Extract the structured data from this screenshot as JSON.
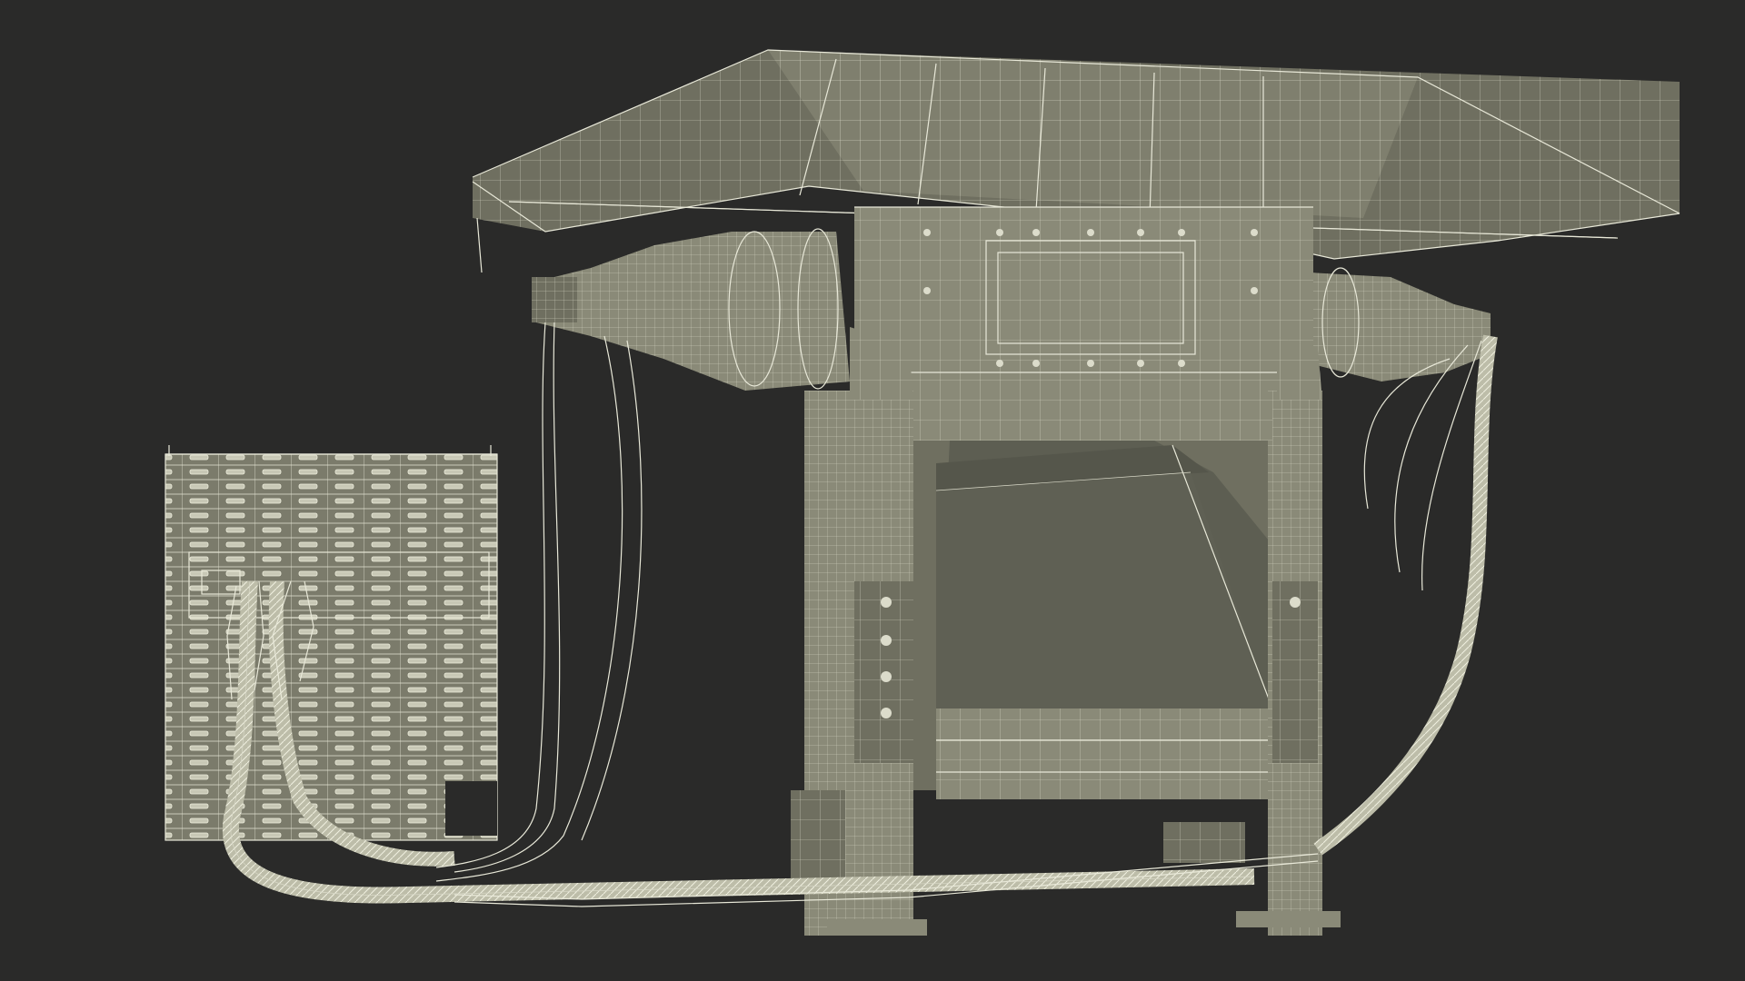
{
  "scene": {
    "background_color": "#2a2a29",
    "wire_color": "#e8e8d8",
    "surface_color": "#8a8a78"
  }
}
